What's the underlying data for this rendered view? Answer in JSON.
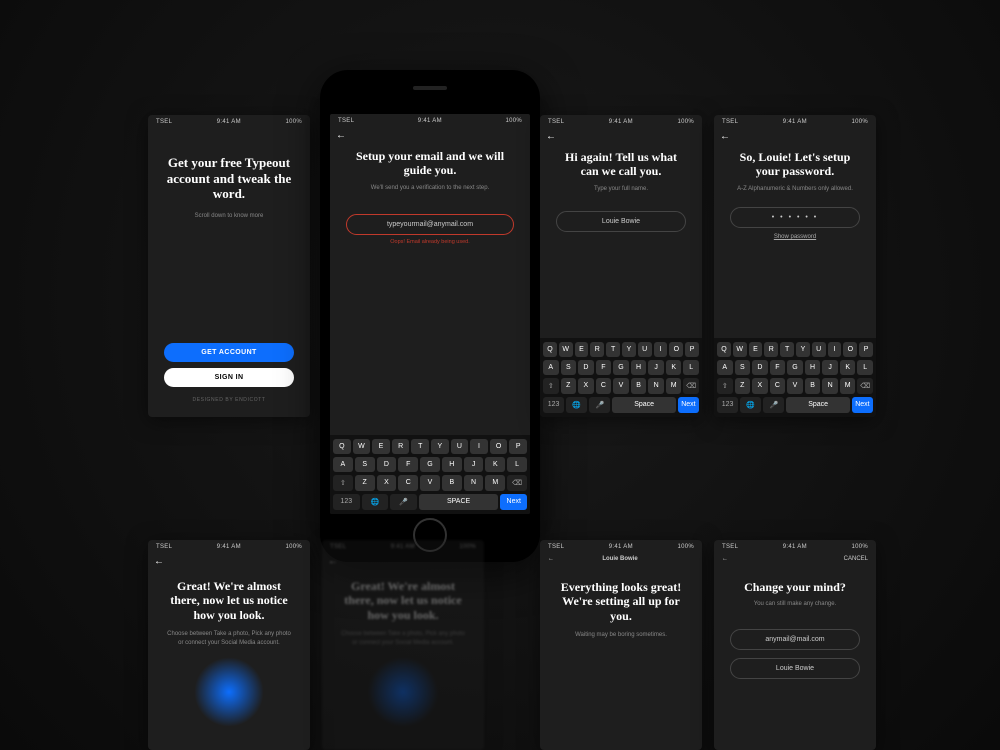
{
  "status": {
    "carrier": "TSEL",
    "time": "9:41 AM",
    "battery": "100%"
  },
  "s1": {
    "heading": "Get your free Typeout account and tweak the word.",
    "sub": "Scroll down to know more",
    "getAccount": "GET ACCOUNT",
    "signIn": "SIGN IN",
    "designed": "DESIGNED BY ENDICOTT"
  },
  "s2": {
    "heading": "Setup your email and we will guide you.",
    "sub": "We'll send you a verification to the next step.",
    "input": "typeyourmail@anymail.com",
    "error": "Oops! Email already being used."
  },
  "s3": {
    "heading": "Hi again! Tell us what can we call you.",
    "sub": "Type your full name.",
    "input": "Louie Bowie"
  },
  "s4": {
    "heading": "So, Louie! Let's setup your password.",
    "sub": "A-Z Alphanumeric & Numbers only allowed.",
    "input": "• • • • • •",
    "show": "Show password"
  },
  "s5": {
    "heading": "Great! We're almost there, now let us notice how you look.",
    "sub": "Choose between Take a photo, Pick any photo or connect your Social Media account."
  },
  "s6": {
    "title": "Louie Bowie",
    "heading": "Everything looks great! We're setting all up for you.",
    "sub": "Waiting may be boring sometimes."
  },
  "s7": {
    "cancel": "CANCEL",
    "heading": "Change your mind?",
    "sub": "You can still make any change.",
    "email": "anymail@mail.com",
    "name": "Louie Bowie"
  },
  "kb": {
    "row1": [
      "Q",
      "W",
      "E",
      "R",
      "T",
      "Y",
      "U",
      "I",
      "O",
      "P"
    ],
    "row2": [
      "A",
      "S",
      "D",
      "F",
      "G",
      "H",
      "J",
      "K",
      "L"
    ],
    "row3": [
      "Z",
      "X",
      "C",
      "V",
      "B",
      "N",
      "M"
    ],
    "shift": "⇧",
    "del": "⌫",
    "num": "123",
    "globe": "🌐",
    "mic": "🎤",
    "space": "Space",
    "spaceUpper": "SPACE",
    "next": "Next"
  }
}
